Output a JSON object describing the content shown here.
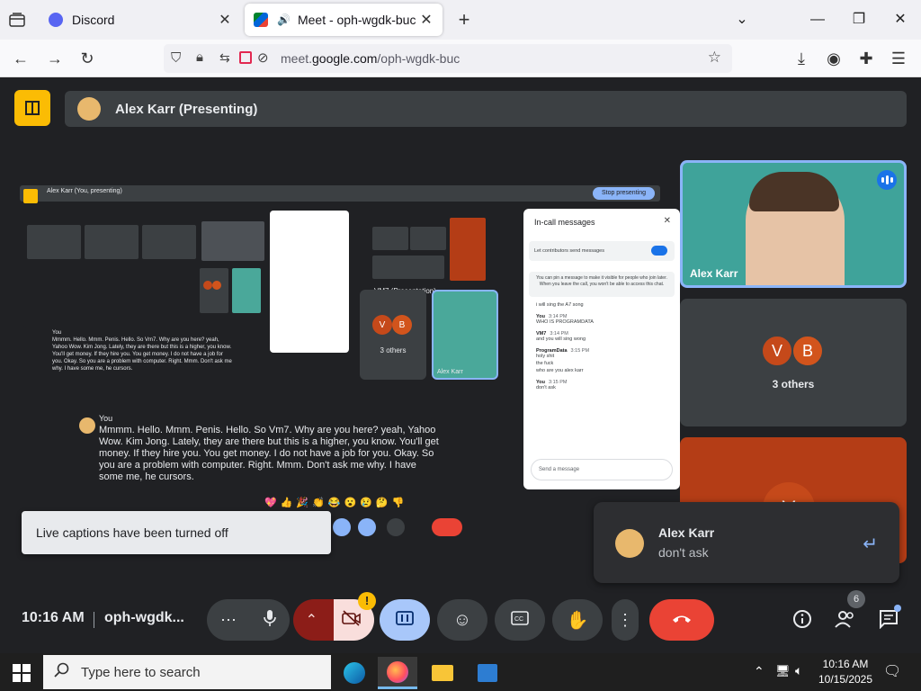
{
  "browser": {
    "tabs": [
      {
        "title": "Discord",
        "active": false
      },
      {
        "title": "Meet - oph-wgdk-buc",
        "active": true
      }
    ],
    "url_prefix": "meet.",
    "url_domain": "google.com",
    "url_path": "/oph-wgdk-buc"
  },
  "meet": {
    "presenter_label": "Alex Karr (Presenting)",
    "mini_presenting_label": "Alex Karr (You, presenting)",
    "mini_stop_label": "Stop presenting",
    "mini_presentation_label": "VM7 (Presentation)",
    "mini_others": "3 others",
    "mini_tile_name": "Alex Karr",
    "mini_caption_speaker": "You",
    "mini_caption_text": "Mmmm. Hello. Mmm. Penis. Hello. So Vm7. Why are you here? yeah, Yahoo Wow. Kim Jong. Lately, they are there but this is a higher, you know. You'll get money. If they hire you. You get money. I do not have a job for you. Okay. So you are a problem with computer. Right. Mmm. Don't ask me why. I have some me, he cursors.",
    "chat": {
      "title": "In-call messages",
      "toggle_label": "Let contributors send messages",
      "info": "You can pin a message to make it visible for people who join later. When you leave the call, you won't be able to access this chat.",
      "messages": [
        {
          "who": "",
          "when": "",
          "text": "i will sing the A7 song"
        },
        {
          "who": "You",
          "when": "3:14 PM",
          "text": "WHO IS PROGRAMDATA"
        },
        {
          "who": "VM7",
          "when": "3:14 PM",
          "text": "and you will sing wong"
        },
        {
          "who": "ProgramData",
          "when": "3:15 PM",
          "text": "holy shit"
        },
        {
          "who": "",
          "when": "",
          "text": "the fuck"
        },
        {
          "who": "",
          "when": "",
          "text": "who are you alex karr"
        },
        {
          "who": "You",
          "when": "3:15 PM",
          "text": "don't ask"
        }
      ],
      "input_placeholder": "Send a message"
    },
    "caption": {
      "speaker": "You",
      "text": "Mmmm. Hello. Mmm. Penis. Hello. So Vm7. Why are you here? yeah, Yahoo Wow. Kim Jong. Lately, they are there but this is a higher, you know. You'll get money. If they hire you. You get money. I do not have a job for you. Okay. So you are a problem with computer. Right. Mmm. Don't ask me why. I have some me, he cursors."
    },
    "reactions": "💖👍🎉👏😂😮😢🤔👎",
    "captions_toast": "Live captions have been turned off",
    "tiles": {
      "self_name": "Alex Karr",
      "others_label": "3 others",
      "avatar_v": "V",
      "avatar_b": "B",
      "colors": {
        "v": "#c5491a",
        "b": "#d2541c"
      }
    },
    "message_toast": {
      "name": "Alex Karr",
      "text": "don't ask"
    },
    "bottom": {
      "time": "10:16 AM",
      "code": "oph-wgdk...",
      "warning_badge": "!",
      "participant_count": "6"
    }
  },
  "taskbar": {
    "search_placeholder": "Type here to search",
    "time": "10:16 AM",
    "date": "10/15/2025"
  }
}
